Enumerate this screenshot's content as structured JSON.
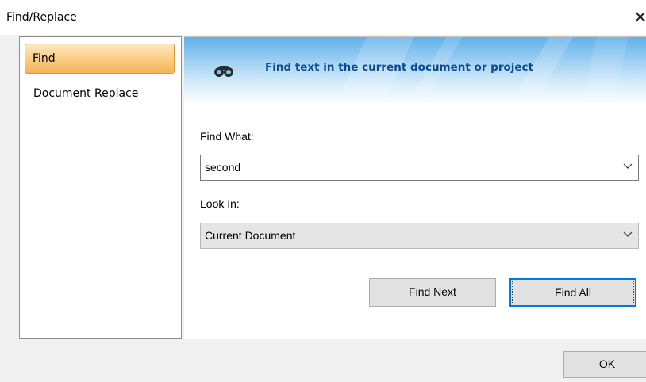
{
  "window": {
    "title": "Find/Replace",
    "close_glyph": "✕"
  },
  "nav": {
    "items": [
      {
        "label": "Find",
        "selected": true
      },
      {
        "label": "Document Replace",
        "selected": false
      }
    ]
  },
  "banner": {
    "icon": "binoculars-icon",
    "text": "Find text in the current document or project"
  },
  "form": {
    "find_what_label": "Find What:",
    "find_what_value": "second",
    "look_in_label": "Look In:",
    "look_in_value": "Current Document"
  },
  "buttons": {
    "find_next": "Find Next",
    "find_all": "Find All",
    "ok": "OK"
  },
  "colors": {
    "selected_nav": "#fbd08a",
    "banner_text": "#0d4c8c",
    "focus_border": "#0078d7"
  }
}
